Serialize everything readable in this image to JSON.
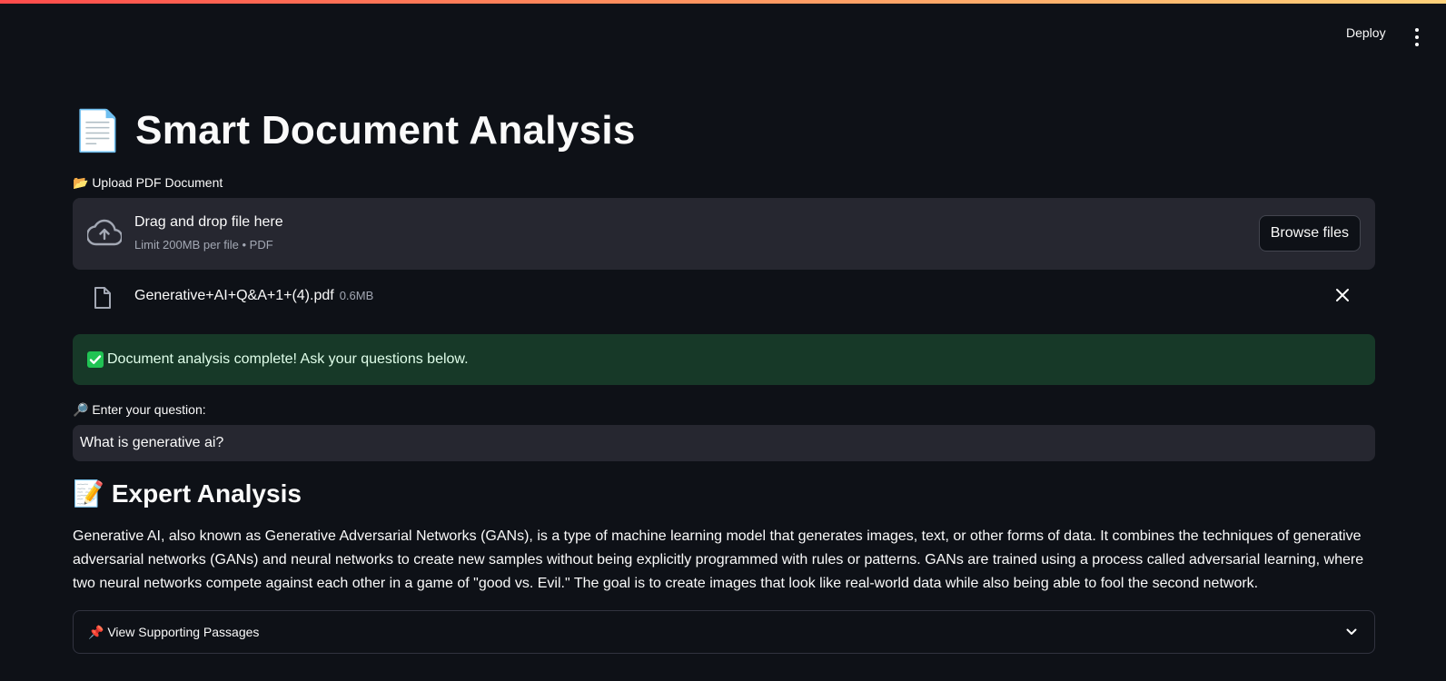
{
  "header": {
    "deploy_label": "Deploy",
    "menu_icon": "kebab-menu-icon"
  },
  "page": {
    "title_emoji": "📄",
    "title": "Smart Document Analysis"
  },
  "uploader": {
    "label": "📂 Upload PDF Document",
    "drop_text": "Drag and drop file here",
    "limit_text": "Limit 200MB per file • PDF",
    "browse_label": "Browse files",
    "icon": "cloud-upload-icon"
  },
  "uploaded_file": {
    "name": "Generative+AI+Q&A+1+(4).pdf",
    "size": "0.6MB",
    "icon": "file-icon",
    "remove_icon": "close-icon"
  },
  "status": {
    "message": "Document analysis complete! Ask your questions below.",
    "color": "#173928"
  },
  "question": {
    "label": "🔎 Enter your question:",
    "value": "What is generative ai?"
  },
  "analysis": {
    "title_emoji": "📝",
    "title": "Expert Analysis",
    "body": "Generative AI, also known as Generative Adversarial Networks (GANs), is a type of machine learning model that generates images, text, or other forms of data. It combines the techniques of generative adversarial networks (GANs) and neural networks to create new samples without being explicitly programmed with rules or patterns. GANs are trained using a process called adversarial learning, where two neural networks compete against each other in a game of \"good vs. Evil.\" The goal is to create images that look like real-world data while also being able to fool the second network."
  },
  "expander": {
    "label": "📌 View Supporting Passages",
    "icon": "chevron-down-icon"
  }
}
